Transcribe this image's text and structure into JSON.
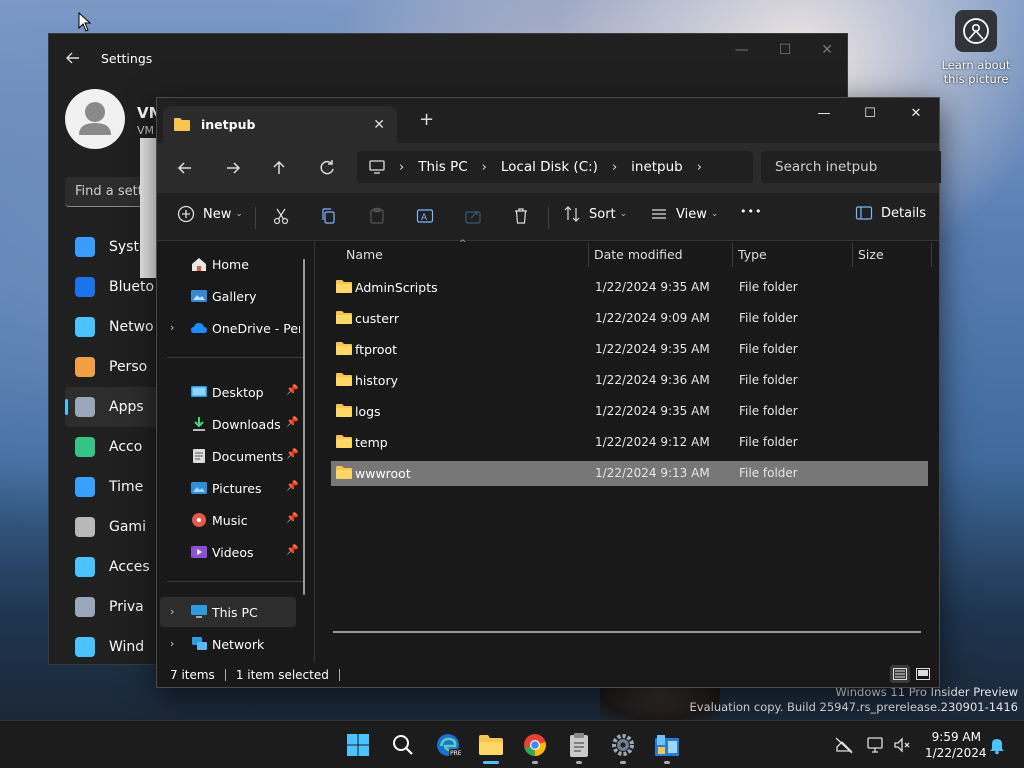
{
  "desktop": {
    "learn_label": "Learn about this picture",
    "watermark_line1": "Windows 11 Pro Insider Preview",
    "watermark_line2": "Evaluation copy. Build 25947.rs_prerelease.230901-1416"
  },
  "settings": {
    "title": "Settings",
    "user_name": "VM",
    "user_sub": "VM",
    "find_placeholder": "Find a setti",
    "nav": [
      {
        "label": "Syste",
        "icon": "system-icon",
        "color": "#3b9cff"
      },
      {
        "label": "Blueto",
        "icon": "bluetooth-icon",
        "color": "#1a73e8"
      },
      {
        "label": "Netwo",
        "icon": "wifi-icon",
        "color": "#4cc2ff"
      },
      {
        "label": "Perso",
        "icon": "brush-icon",
        "color": "#f0a040"
      },
      {
        "label": "Apps",
        "icon": "apps-icon",
        "color": "#9aa7b8"
      },
      {
        "label": "Acco",
        "icon": "account-icon",
        "color": "#35c486"
      },
      {
        "label": "Time",
        "icon": "clock-icon",
        "color": "#38a0ff"
      },
      {
        "label": "Gami",
        "icon": "gamepad-icon",
        "color": "#b8b8b8"
      },
      {
        "label": "Acces",
        "icon": "accessibility-icon",
        "color": "#4cc2ff"
      },
      {
        "label": "Priva",
        "icon": "shield-icon",
        "color": "#9aa7b8"
      },
      {
        "label": "Wind",
        "icon": "update-icon",
        "color": "#4cc2ff"
      }
    ]
  },
  "explorer": {
    "tab_title": "inetpub",
    "breadcrumbs": [
      "This PC",
      "Local Disk (C:)",
      "inetpub"
    ],
    "search_placeholder": "Search inetpub",
    "toolbar": {
      "new": "New",
      "sort": "Sort",
      "view": "View",
      "more": "•••",
      "details": "Details"
    },
    "sidebar": {
      "home": "Home",
      "gallery": "Gallery",
      "onedrive": "OneDrive - Personal",
      "desktop": "Desktop",
      "downloads": "Downloads",
      "documents": "Documents",
      "pictures": "Pictures",
      "music": "Music",
      "videos": "Videos",
      "this_pc": "This PC",
      "network": "Network"
    },
    "columns": {
      "name": "Name",
      "date": "Date modified",
      "type": "Type",
      "size": "Size"
    },
    "rows": [
      {
        "name": "AdminScripts",
        "date": "1/22/2024 9:35 AM",
        "type": "File folder"
      },
      {
        "name": "custerr",
        "date": "1/22/2024 9:09 AM",
        "type": "File folder"
      },
      {
        "name": "ftproot",
        "date": "1/22/2024 9:35 AM",
        "type": "File folder"
      },
      {
        "name": "history",
        "date": "1/22/2024 9:36 AM",
        "type": "File folder"
      },
      {
        "name": "logs",
        "date": "1/22/2024 9:35 AM",
        "type": "File folder"
      },
      {
        "name": "temp",
        "date": "1/22/2024 9:12 AM",
        "type": "File folder"
      },
      {
        "name": "wwwroot",
        "date": "1/22/2024 9:13 AM",
        "type": "File folder"
      }
    ],
    "status": {
      "items": "7 items",
      "selected": "1 item selected"
    }
  },
  "taskbar": {
    "time": "9:59 AM",
    "date": "1/22/2024"
  },
  "colors": {
    "accent": "#4cc2ff",
    "folder": "#f5c451",
    "selected_row": "#777777"
  }
}
